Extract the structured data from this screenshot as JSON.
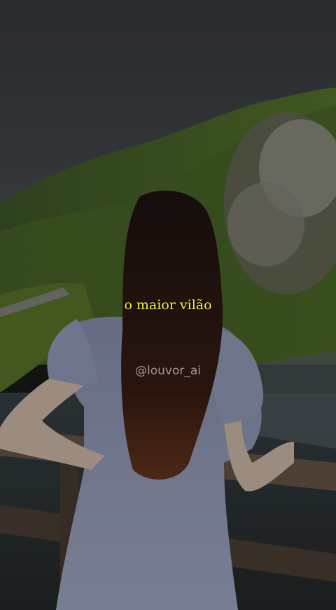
{
  "video": {
    "caption": "o maior vilão",
    "watermark": "@louvor_ai",
    "caption_color": "#f5f044"
  }
}
